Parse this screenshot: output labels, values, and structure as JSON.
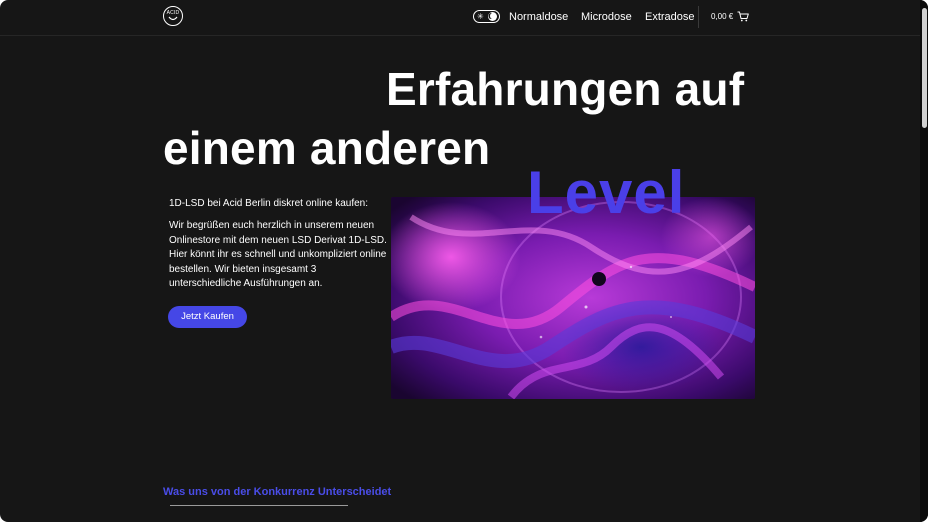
{
  "header": {
    "logo_text": "ACID",
    "nav": [
      "Normaldose",
      "Microdose",
      "Extradose"
    ],
    "cart_total": "0,00 €",
    "icons": {
      "theme_toggle": "sun-moon-toggle-icon",
      "cart": "shopping-cart-icon"
    }
  },
  "hero": {
    "headline_line1": "Erfahrungen auf",
    "headline_line2": "einem anderen",
    "headline_line3": "Level",
    "intro_title": "1D-LSD bei Acid Berlin diskret online kaufen:",
    "intro_body": "Wir begrüßen euch herzlich in unserem neuen Onlinestore mit dem neuen LSD Derivat 1D-LSD. Hier könnt ihr es schnell und unkompliziert online bestellen. Wir bieten insgesamt 3 unterschiedliche Ausführungen an.",
    "cta_label": "Jetzt Kaufen"
  },
  "sections": {
    "differentiator_title": "Was uns von der Konkurrenz Unterscheidet"
  },
  "colors": {
    "background": "#161616",
    "accent": "#4547e6",
    "text": "#ffffff"
  }
}
